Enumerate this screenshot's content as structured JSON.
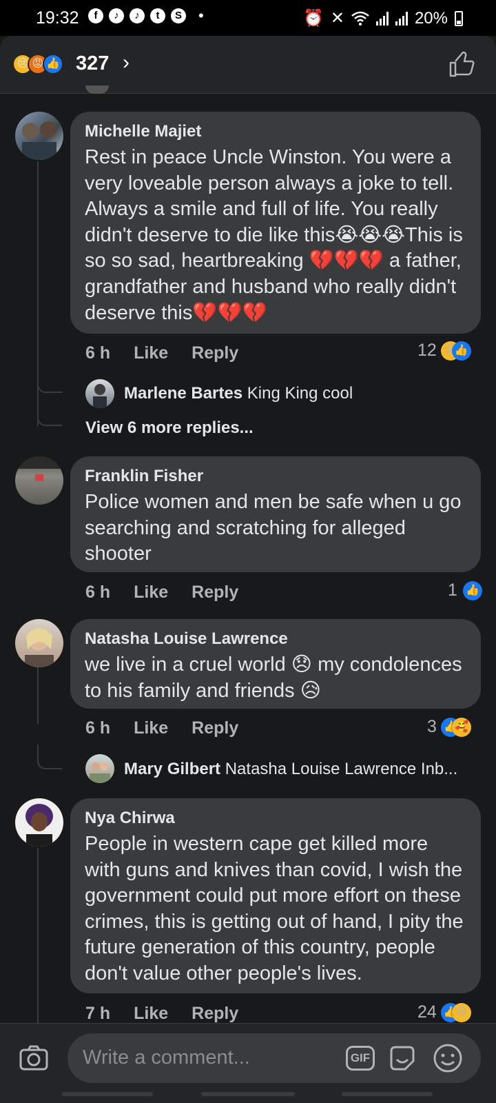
{
  "status_bar": {
    "time": "19:32",
    "app_icons": [
      "f",
      "♪",
      "♪",
      "t",
      "S"
    ],
    "battery": "20%"
  },
  "header": {
    "reaction_count": "327",
    "reaction_icons": [
      "sad-reaction",
      "angry-reaction",
      "like-reaction"
    ]
  },
  "comments": [
    {
      "name": "Michelle Majiet",
      "text": "Rest in peace Uncle Winston. You were a very loveable person always a joke to tell. Always a smile and full of life. You really didn't deserve to die like this😭😭😭This is so so sad, heartbreaking 💔💔💔 a father, grandfather and husband who really didn't deserve this💔💔💔",
      "time": "6 h",
      "like": "Like",
      "reply": "Reply",
      "reaction_count": "12",
      "reply_preview": {
        "name": "Marlene Bartes",
        "text": "King King cool"
      },
      "more_replies": "View 6 more replies..."
    },
    {
      "name": "Franklin Fisher",
      "text": "Police women and men be safe when u go searching and scratching for alleged shooter",
      "time": "6 h",
      "like": "Like",
      "reply": "Reply",
      "reaction_count": "1"
    },
    {
      "name": "Natasha Louise Lawrence",
      "text": "we live in a cruel world 😞 my condolences to his family and friends 😥",
      "time": "6 h",
      "like": "Like",
      "reply": "Reply",
      "reaction_count": "3",
      "reply_preview": {
        "name": "Mary Gilbert",
        "text": "Natasha Louise Lawrence Inb..."
      }
    },
    {
      "name": "Nya Chirwa",
      "text": "People in western cape get killed more with guns and knives than covid, I wish the government could put more effort on these crimes, this is getting out of hand, I pity the future generation of this country, people don't value other people's lives.",
      "time": "7 h",
      "like": "Like",
      "reply": "Reply",
      "reaction_count": "24"
    }
  ],
  "composer": {
    "placeholder": "Write a comment...",
    "gif_label": "GIF"
  },
  "colors": {
    "background": "#18191a",
    "bubble": "#3a3b3c",
    "like_blue": "#1877f2",
    "secondary_text": "#b0b3b8"
  }
}
